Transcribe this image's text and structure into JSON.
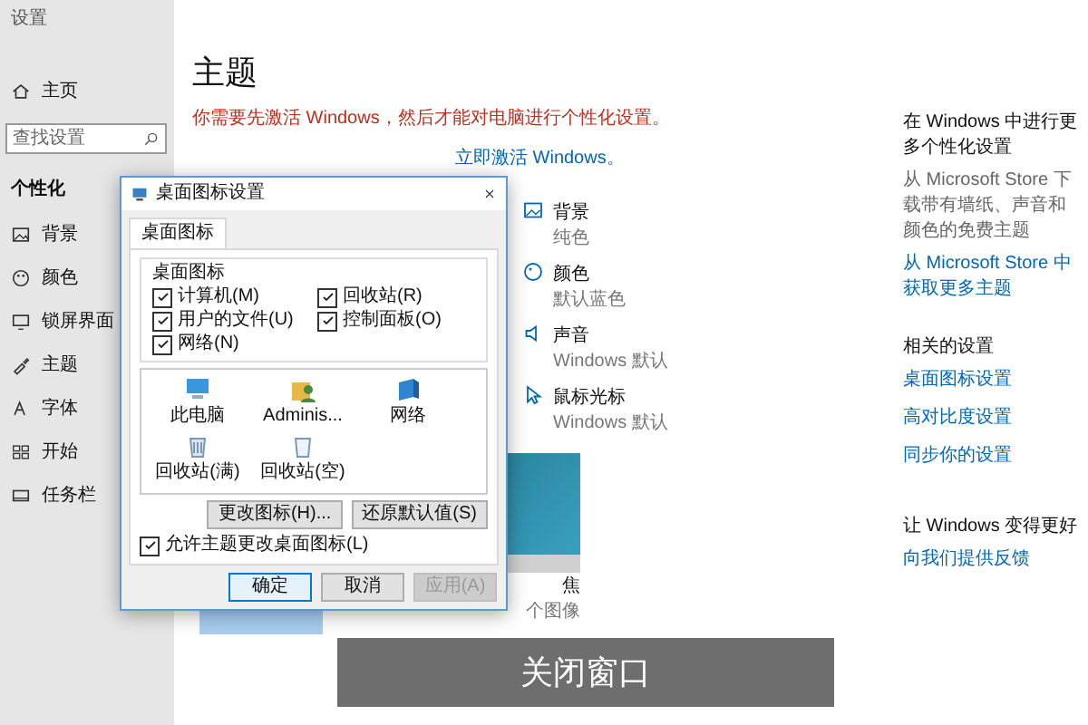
{
  "window": {
    "title": "设置"
  },
  "sidebar": {
    "home": "主页",
    "search": {
      "placeholder": "查找设置"
    },
    "section": "个性化",
    "items": [
      {
        "label": "背景"
      },
      {
        "label": "颜色"
      },
      {
        "label": "锁屏界面"
      },
      {
        "label": "主题"
      },
      {
        "label": "字体"
      },
      {
        "label": "开始"
      },
      {
        "label": "任务栏"
      }
    ]
  },
  "main": {
    "heading": "主题",
    "warning": "你需要先激活 Windows，然后才能对电脑进行个性化设置。",
    "activate_link": "立即激活 Windows。",
    "theme_properties": [
      {
        "name": "背景",
        "value": "纯色"
      },
      {
        "name": "颜色",
        "value": "默认蓝色"
      },
      {
        "name": "声音",
        "value": "Windows 默认"
      },
      {
        "name": "鼠标光标",
        "value": "Windows 默认"
      }
    ],
    "theme_tile": {
      "name": "焦",
      "detail": "个图像"
    }
  },
  "right_panel": {
    "more": {
      "heading": "在 Windows 中进行更多个性化设置",
      "text": "从 Microsoft Store 下载带有墙纸、声音和颜色的免费主题",
      "link": "从 Microsoft Store 中获取更多主题"
    },
    "related": {
      "heading": "相关的设置",
      "links": [
        "桌面图标设置",
        "高对比度设置",
        "同步你的设置"
      ]
    },
    "feedback": {
      "heading": "让 Windows 变得更好",
      "link": "向我们提供反馈"
    }
  },
  "dialog": {
    "title": "桌面图标设置",
    "tabs": [
      {
        "label": "桌面图标",
        "selected": true
      }
    ],
    "group_label": "桌面图标",
    "checkboxes": [
      {
        "label": "计算机(M)",
        "checked": true
      },
      {
        "label": "回收站(R)",
        "checked": true
      },
      {
        "label": "用户的文件(U)",
        "checked": true
      },
      {
        "label": "控制面板(O)",
        "checked": true
      },
      {
        "label": "网络(N)",
        "checked": true
      }
    ],
    "icons": [
      {
        "label": "此电脑"
      },
      {
        "label": "Adminis..."
      },
      {
        "label": "网络"
      },
      {
        "label": "回收站(满)"
      },
      {
        "label": "回收站(空)"
      }
    ],
    "icon_buttons": [
      "更改图标(H)...",
      "还原默认值(S)"
    ],
    "allow_theme": {
      "label": "允许主题更改桌面图标(L)",
      "checked": true
    },
    "buttons": [
      {
        "label": "确定",
        "default": true,
        "disabled": false
      },
      {
        "label": "取消",
        "default": false,
        "disabled": false
      },
      {
        "label": "应用(A)",
        "default": false,
        "disabled": true
      }
    ]
  },
  "caption": "关闭窗口"
}
